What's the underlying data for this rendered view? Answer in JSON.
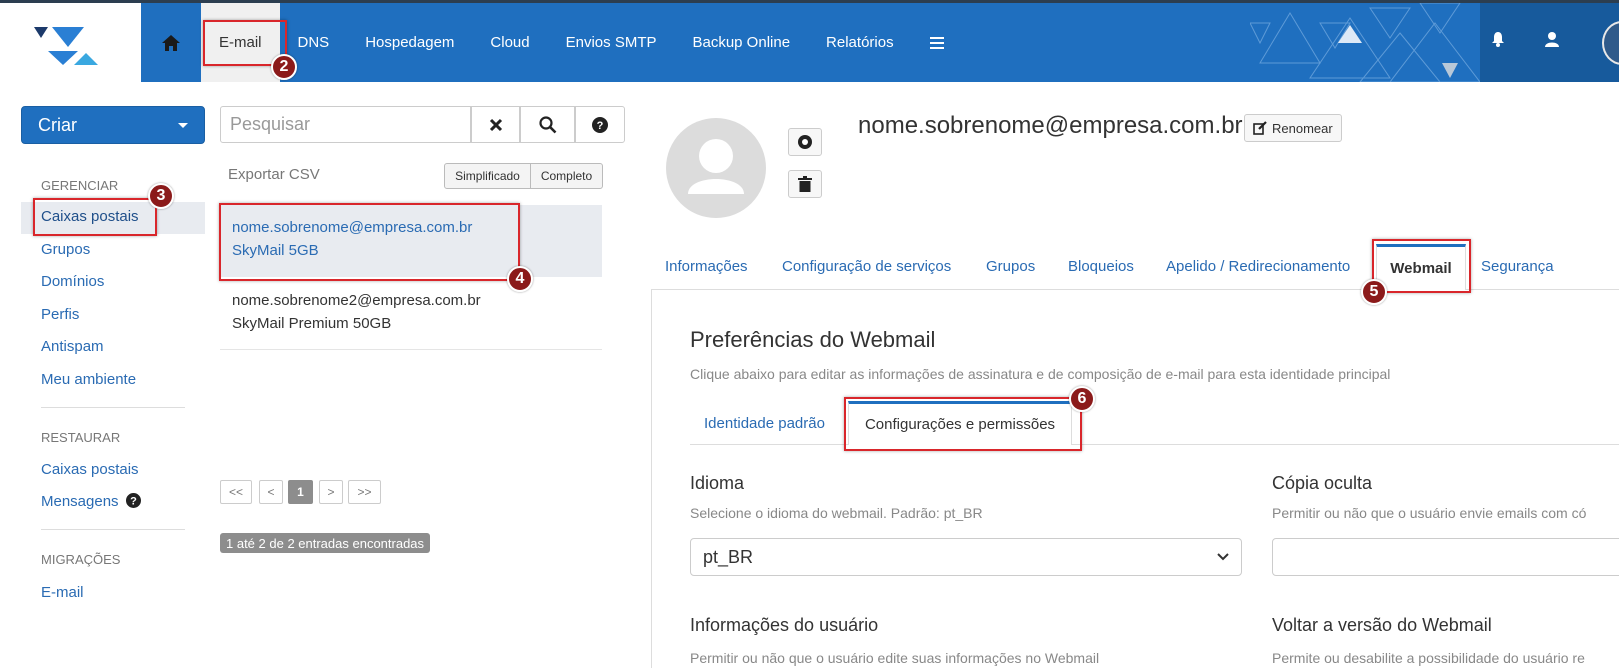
{
  "nav": {
    "items": [
      {
        "label": "E-mail",
        "active": true
      },
      {
        "label": "DNS"
      },
      {
        "label": "Hospedagem"
      },
      {
        "label": "Cloud"
      },
      {
        "label": "Envios SMTP"
      },
      {
        "label": "Backup Online"
      },
      {
        "label": "Relatórios"
      }
    ]
  },
  "badges": {
    "b2": "2",
    "b3": "3",
    "b4": "4",
    "b5": "5",
    "b6": "6"
  },
  "sidebar": {
    "create_label": "Criar",
    "sections": [
      {
        "heading": "GERENCIAR",
        "items": [
          "Caixas postais",
          "Grupos",
          "Domínios",
          "Perfis",
          "Antispam",
          "Meu ambiente"
        ]
      },
      {
        "heading": "RESTAURAR",
        "items": [
          "Caixas postais",
          "Mensagens"
        ]
      },
      {
        "heading": "MIGRAÇÕES",
        "items": [
          "E-mail"
        ]
      }
    ]
  },
  "list": {
    "search_placeholder": "Pesquisar",
    "export_label": "Exportar CSV",
    "view_simple": "Simplificado",
    "view_full": "Completo",
    "rows": [
      {
        "email": "nome.sobrenome@empresa.com.br",
        "plan": "SkyMail 5GB"
      },
      {
        "email": "nome.sobrenome2@empresa.com.br",
        "plan": "SkyMail Premium 50GB"
      }
    ],
    "pager": [
      "<<",
      "<",
      "1",
      ">",
      ">>"
    ],
    "count_text": "1 até 2 de 2 entradas encontradas"
  },
  "detail": {
    "title": "nome.sobrenome@empresa.com.br",
    "rename_label": "Renomear",
    "tabs": [
      "Informações",
      "Configuração de serviços",
      "Grupos",
      "Bloqueios",
      "Apelido / Redirecionamento",
      "Webmail",
      "Segurança"
    ],
    "section_title": "Preferências do Webmail",
    "section_desc": "Clique abaixo para editar as informações de assinatura e de composição de e-mail para esta identidade principal",
    "subtabs": [
      "Identidade padrão",
      "Configurações e permissões"
    ],
    "fields": {
      "idioma_label": "Idioma",
      "idioma_desc": "Selecione o idioma do webmail. Padrão: pt_BR",
      "idioma_value": "pt_BR",
      "copia_label": "Cópia oculta",
      "copia_desc": "Permitir ou não que o usuário envie emails com có",
      "info_label": "Informações do usuário",
      "info_desc": "Permitir ou não que o usuário edite suas informações no Webmail",
      "voltar_label": "Voltar a versão do Webmail",
      "voltar_desc": "Permite ou desabilite a possibilidade do usuário re"
    }
  },
  "colors": {
    "primary": "#1f6fbf",
    "highlight": "#d9262b",
    "badge": "#8b1a1a",
    "link": "#2a6bb3"
  }
}
